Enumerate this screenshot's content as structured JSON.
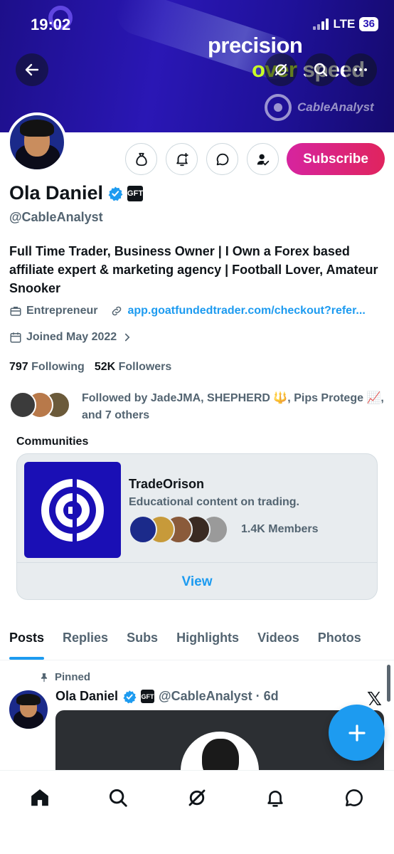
{
  "status_bar": {
    "time": "19:02",
    "network": "LTE",
    "battery": "36"
  },
  "banner": {
    "headline_line1": "precision",
    "headline_line2_part1": "over",
    "headline_line2_part2": "speed",
    "brand": "CableAnalyst",
    "colors": {
      "background": "#2a17b5",
      "accent": "#c9ff27"
    }
  },
  "header_buttons": {
    "back_icon": "arrow-left-icon",
    "grok_icon": "grok-icon",
    "search_icon": "search-icon",
    "more_icon": "more-icon"
  },
  "profile": {
    "name": "Ola Daniel",
    "affiliate_badge": "GFT",
    "handle": "@CableAnalyst",
    "bio": "Full Time Trader, Business Owner | I Own a Forex based affiliate expert & marketing agency | Football Lover, Amateur Snooker",
    "category": "Entrepreneur",
    "link": "app.goatfundedtrader.com/checkout?refer...",
    "joined": "Joined May 2022",
    "following_count": "797",
    "following_label": "Following",
    "followers_count": "52K",
    "followers_label": "Followers",
    "followed_by": "Followed by JadeJMA, SHEPHERD 🔱, Pips Protege 📈, and 7 others"
  },
  "actions": {
    "tip_icon": "money-bag-icon",
    "notify_icon": "bell-plus-icon",
    "message_icon": "message-icon",
    "following_icon": "person-check-icon",
    "subscribe_label": "Subscribe",
    "subscribe_color": "#d6249f"
  },
  "communities": {
    "title": "Communities",
    "items": [
      {
        "name": "TradeOrison",
        "description": "Educational content on trading.",
        "members": "1.4K Members",
        "view_label": "View"
      }
    ]
  },
  "tabs": [
    {
      "label": "Posts",
      "active": true
    },
    {
      "label": "Replies",
      "active": false
    },
    {
      "label": "Subs",
      "active": false
    },
    {
      "label": "Highlights",
      "active": false
    },
    {
      "label": "Videos",
      "active": false
    },
    {
      "label": "Photos",
      "active": false
    }
  ],
  "pinned_post": {
    "pinned_label": "Pinned",
    "author": "Ola Daniel",
    "affiliate_badge": "GFT",
    "handle_time": "@CableAnalyst · 6d",
    "source_icon": "x-logo-icon"
  },
  "fab": {
    "icon": "plus-icon",
    "color": "#1d9bf0"
  },
  "bottom_nav": [
    {
      "name": "home",
      "icon": "home-icon"
    },
    {
      "name": "search",
      "icon": "search-icon"
    },
    {
      "name": "grok",
      "icon": "grok-icon"
    },
    {
      "name": "notifications",
      "icon": "bell-icon"
    },
    {
      "name": "messages",
      "icon": "message-icon"
    }
  ]
}
